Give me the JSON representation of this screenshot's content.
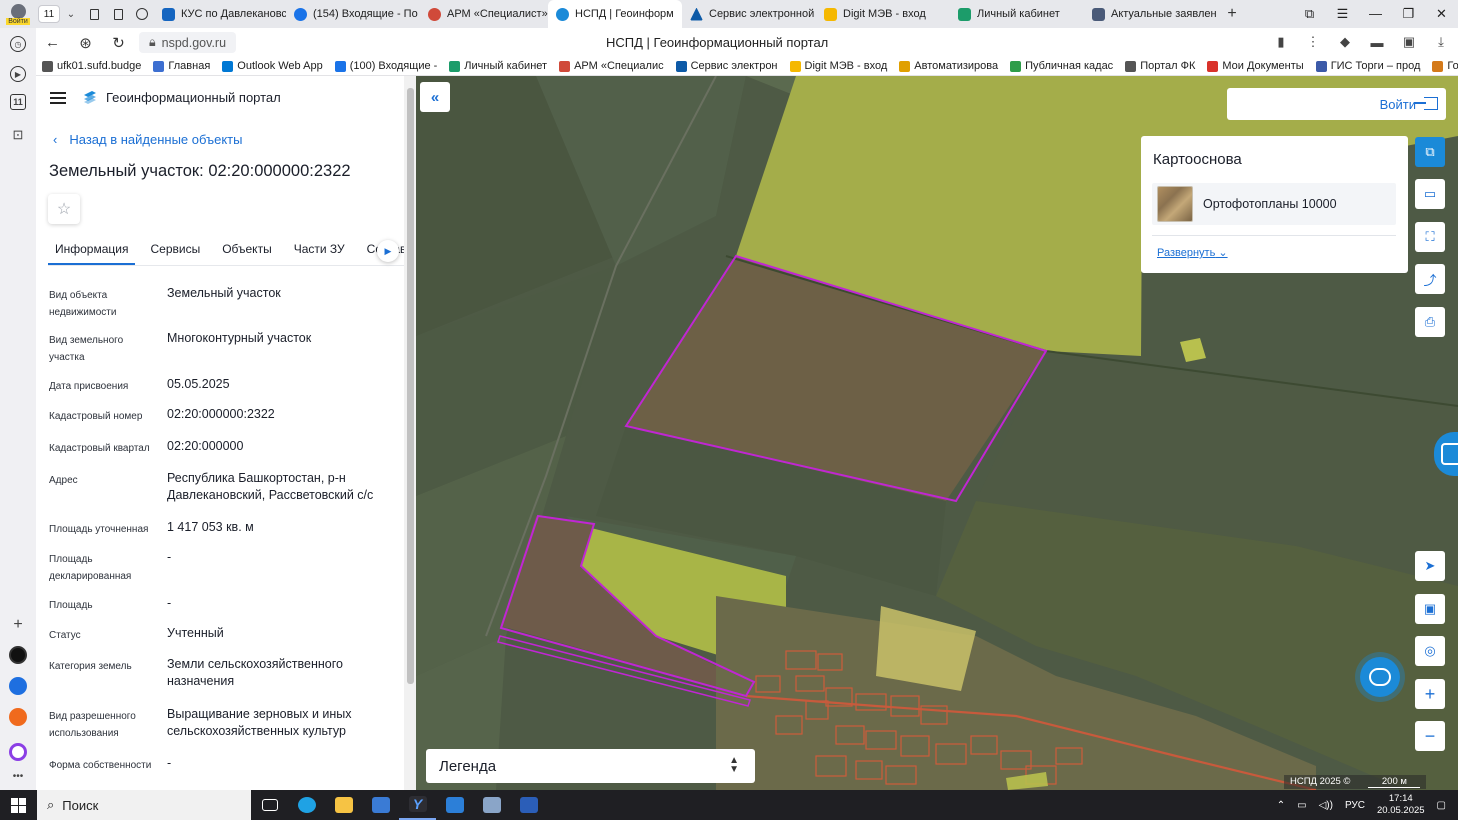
{
  "browser": {
    "user_label": "Войти",
    "tab_count": "11",
    "tabs": [
      {
        "label": "КУС по Давлекановск",
        "color": "#1565c0"
      },
      {
        "label": "(154) Входящие - По",
        "color": "#1a73e8"
      },
      {
        "label": "АРМ «Специалист»",
        "color": "#d04a3a"
      },
      {
        "label": "НСПД | Геоинформ",
        "color": "#1b8ad8",
        "active": true
      },
      {
        "label": "Сервис электронной",
        "color": "#0d5aa7"
      },
      {
        "label": "Digit МЭВ - вход",
        "color": "#f5b800"
      },
      {
        "label": "Личный кабинет",
        "color": "#1c9c6a"
      },
      {
        "label": "Актуальные заявлен",
        "color": "#4a5a78"
      }
    ],
    "url": "nspd.gov.ru",
    "page_title": "НСПД | Геоинформационный портал",
    "bookmarks": [
      {
        "label": "ufk01.sufd.budge",
        "color": "#555"
      },
      {
        "label": "Главная",
        "color": "#3d6fd1"
      },
      {
        "label": "Outlook Web App",
        "color": "#0078d4"
      },
      {
        "label": "(100) Входящие -",
        "color": "#1a73e8"
      },
      {
        "label": "Личный кабинет",
        "color": "#1c9c6a"
      },
      {
        "label": "АРМ «Специалис",
        "color": "#d04a3a"
      },
      {
        "label": "Сервис электрон",
        "color": "#0d5aa7"
      },
      {
        "label": "Digit МЭВ - вход",
        "color": "#f5b800"
      },
      {
        "label": "Автоматизирова",
        "color": "#e0a000"
      },
      {
        "label": "Публичная кадас",
        "color": "#2e9d4a"
      },
      {
        "label": "Портал ФК",
        "color": "#555"
      },
      {
        "label": "Мои Документы",
        "color": "#d9322b"
      },
      {
        "label": "ГИС Торги – прод",
        "color": "#3c5aa8"
      },
      {
        "label": "Городские",
        "color": "#d47a1b"
      }
    ],
    "sidebar_badge": "11"
  },
  "panel": {
    "portal_name": "Геоинформационный портал",
    "back_link": "Назад в найденные объекты",
    "title": "Земельный участок: 02:20:000000:2322",
    "tabs": [
      "Информация",
      "Сервисы",
      "Объекты",
      "Части ЗУ",
      "Состав ЗУ"
    ],
    "properties": [
      {
        "key": "Вид объекта недвижимости",
        "value": "Земельный участок"
      },
      {
        "key": "Вид земельного участка",
        "value": "Многоконтурный участок"
      },
      {
        "key": "Дата присвоения",
        "value": "05.05.2025"
      },
      {
        "key": "Кадастровый номер",
        "value": "02:20:000000:2322"
      },
      {
        "key": "Кадастровый квартал",
        "value": "02:20:000000"
      },
      {
        "key": "Адрес",
        "value": "Республика Башкортостан, р-н Давлекановский, Рассветовский с/с"
      },
      {
        "key": "Площадь уточненная",
        "value": "1 417 053 кв. м"
      },
      {
        "key": "Площадь декларированная",
        "value": "-"
      },
      {
        "key": "Площадь",
        "value": "-"
      },
      {
        "key": "Статус",
        "value": "Учтенный"
      },
      {
        "key": "Категория земель",
        "value": "Земли сельскохозяйственного назначения"
      },
      {
        "key": "Вид разрешенного использования",
        "value": "Выращивание зерновых и иных сельскохозяйственных культур"
      },
      {
        "key": "Форма собственности",
        "value": "-"
      }
    ]
  },
  "map": {
    "login_label": "Войти",
    "basemap_title": "Картооснова",
    "basemap_layer": "Ортофотопланы 10000",
    "basemap_expand": "Развернуть",
    "legend_label": "Легенда",
    "attribution": "НСПД 2025 ©",
    "scale_label": "200 м",
    "parcel_outline_color": "#c026d3",
    "accent_color": "#1b8ad8"
  },
  "taskbar": {
    "search_label": "Поиск",
    "language": "РУС",
    "time": "17:14",
    "date": "20.05.2025"
  }
}
